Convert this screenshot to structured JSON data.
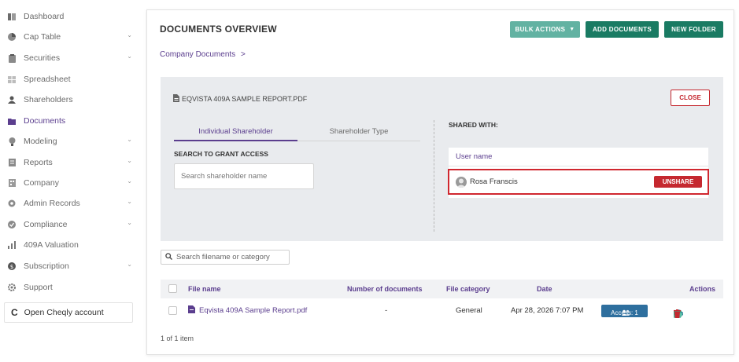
{
  "sidebar": {
    "items": [
      {
        "label": "Dashboard",
        "icon": "dashboard-icon",
        "expandable": false
      },
      {
        "label": "Cap Table",
        "icon": "pie-chart-icon",
        "expandable": true
      },
      {
        "label": "Securities",
        "icon": "clipboard-icon",
        "expandable": true
      },
      {
        "label": "Spreadsheet",
        "icon": "spreadsheet-icon",
        "expandable": false
      },
      {
        "label": "Shareholders",
        "icon": "person-icon",
        "expandable": false
      },
      {
        "label": "Documents",
        "icon": "folder-icon",
        "expandable": false,
        "active": true
      },
      {
        "label": "Modeling",
        "icon": "lightbulb-icon",
        "expandable": true
      },
      {
        "label": "Reports",
        "icon": "report-icon",
        "expandable": true
      },
      {
        "label": "Company",
        "icon": "building-icon",
        "expandable": true
      },
      {
        "label": "Admin Records",
        "icon": "admin-records-icon",
        "expandable": true
      },
      {
        "label": "Compliance",
        "icon": "shield-check-icon",
        "expandable": true
      },
      {
        "label": "409A Valuation",
        "icon": "chart-icon",
        "expandable": false
      },
      {
        "label": "Subscription",
        "icon": "dollar-icon",
        "expandable": true
      },
      {
        "label": "Support",
        "icon": "gear-icon",
        "expandable": false
      }
    ],
    "open_account_label": "Open Cheqly account",
    "open_account_logo": "C"
  },
  "header": {
    "title": "DOCUMENTS OVERVIEW",
    "bulk_actions_label": "BULK ACTIONS",
    "add_documents_label": "ADD DOCUMENTS",
    "new_folder_label": "NEW FOLDER",
    "breadcrumb": "Company Documents",
    "breadcrumb_sep": ">"
  },
  "share_panel": {
    "file_name": "EQVISTA 409A SAMPLE REPORT.PDF",
    "close_label": "CLOSE",
    "tabs": [
      "Individual Shareholder",
      "Shareholder Type"
    ],
    "active_tab": "Individual Shareholder",
    "search_label": "SEARCH TO GRANT ACCESS",
    "search_placeholder": "Search shareholder name",
    "shared_with_label": "SHARED WITH:",
    "user_name_header": "User name",
    "shared_users": [
      {
        "name": "Rosa Franscis"
      }
    ],
    "unshare_label": "UNSHARE"
  },
  "file_search": {
    "placeholder": "Search filename or category"
  },
  "table": {
    "headers": {
      "file_name": "File name",
      "num_docs": "Number of documents",
      "category": "File category",
      "date": "Date",
      "actions": "Actions"
    },
    "rows": [
      {
        "file_name": "Eqvista 409A Sample Report.pdf",
        "num_docs": "-",
        "category": "General",
        "date": "Apr 28, 2026 7:07 PM",
        "access": "Access: 1"
      }
    ],
    "footer": "1 of 1 item"
  },
  "colors": {
    "accent_purple": "#5b3e8e",
    "primary_green": "#1a7b63",
    "light_green": "#62b2a2",
    "danger_red": "#c5282f",
    "access_blue": "#2e6f9e"
  }
}
